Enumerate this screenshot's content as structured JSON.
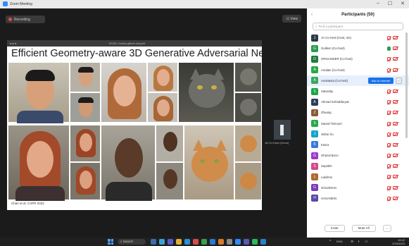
{
  "window": {
    "title": "Zoom Meeting",
    "controls": [
      "–",
      "☐",
      "✕"
    ]
  },
  "meeting": {
    "recording_label": "Recording",
    "layout_label": "☷ View",
    "share_bar_left": "● ● ●",
    "share_bar_url": "EG3D: nvlabs.github.io/eg3d",
    "slide_title": "Efficient Geometry-aware 3D Generative Adversarial Networks",
    "slide_credit": "Chan et al. CVPR 2022",
    "thumbnail_name": "JA Co-Host (Zoom)"
  },
  "participants": {
    "header": "Participants (50)",
    "collapse_icon": "chevron-left-icon",
    "search_placeholder": "Find a participant",
    "admit_label": "Ask to Unmute",
    "more_label": "…",
    "footer": {
      "invite": "Invite",
      "mute_all": "Mute All",
      "more": "…"
    },
    "items": [
      {
        "name": "JA Co-Host (Host, me)",
        "color": "#2e3a4a",
        "initial": "J",
        "status": "muted"
      },
      {
        "name": "Guillem (Co-host)",
        "color": "#2a9d4b",
        "initial": "G",
        "status": "speaking"
      },
      {
        "name": "ORGANIZER (Co-host)",
        "color": "#1e7d3a",
        "initial": "O",
        "status": "muted"
      },
      {
        "name": "Arsalan (Co-host)",
        "color": "#2aa84a",
        "initial": "A",
        "status": "muted"
      },
      {
        "name": "Anastasia (Co-host)",
        "color": "#3aa85a",
        "initial": "A",
        "status": "admit"
      },
      {
        "name": "Saturday",
        "color": "#1fa34a",
        "initial": "S",
        "status": "muted"
      },
      {
        "name": "Ahmad Sohrabbeyan",
        "color": "#2d3e5a",
        "initial": "A",
        "status": "muted"
      },
      {
        "name": "Zhuang",
        "color": "#8a5a3a",
        "initial": "Z",
        "status": "muted"
      },
      {
        "name": "Saeed Teimoori",
        "color": "#2aa84a",
        "initial": "S",
        "status": "muted"
      },
      {
        "name": "Jiahui Xu",
        "color": "#1aa3c8",
        "initial": "J",
        "status": "muted"
      },
      {
        "name": "Kasra",
        "color": "#3a7bd5",
        "initial": "K",
        "status": "muted"
      },
      {
        "name": "Ghazal Bozo",
        "color": "#9b3cc8",
        "initial": "G",
        "status": "muted"
      },
      {
        "name": "Sepideh",
        "color": "#d04a8a",
        "initial": "S",
        "status": "muted"
      },
      {
        "name": "Lakshmi",
        "color": "#b06a30",
        "initial": "L",
        "status": "muted"
      },
      {
        "name": "GOLDMAN",
        "color": "#7a3cb8",
        "initial": "G",
        "status": "muted"
      },
      {
        "name": "HASANEIN",
        "color": "#5a4aa8",
        "initial": "H",
        "status": "muted"
      }
    ]
  },
  "taskbar": {
    "search_label": "Search",
    "tray_time": "10:42",
    "tray_date": "2/15/2023",
    "tray_lang": "ENG"
  },
  "colors": {
    "accent": "#1a73e8",
    "muted_red": "#d33333",
    "speaking_green": "#2a9d4b"
  }
}
